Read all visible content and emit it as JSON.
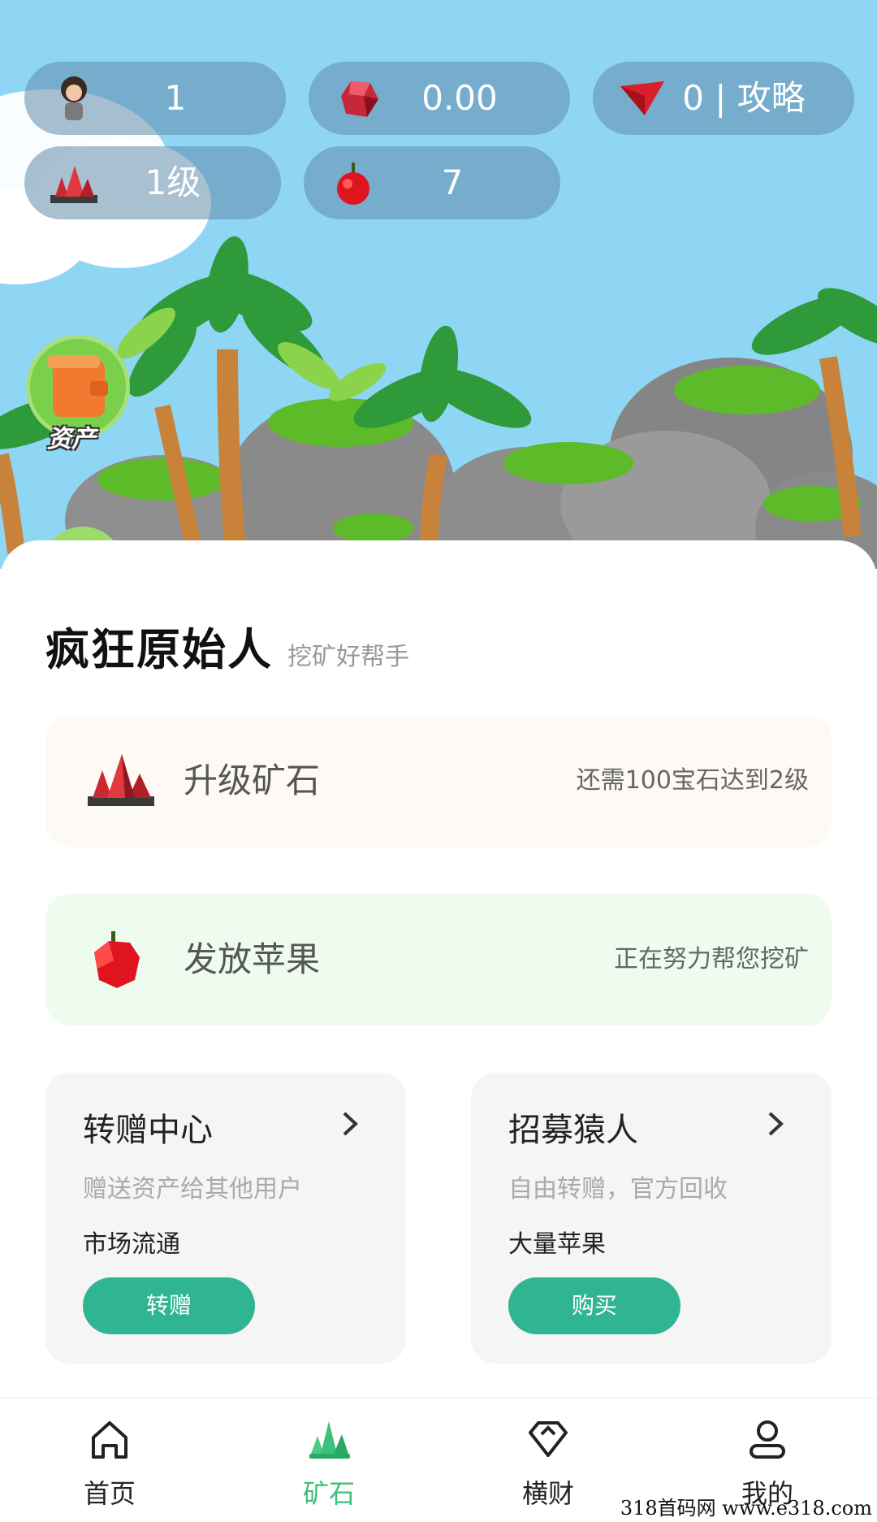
{
  "stats": {
    "avatar_count": "1",
    "gem_balance": "0.00",
    "guide": "0 | 攻略",
    "ore_level": "1级",
    "apple_count": "7"
  },
  "side": {
    "asset_label": "资产"
  },
  "header": {
    "title": "疯狂原始人",
    "subtitle": "挖矿好帮手"
  },
  "upgrade_card": {
    "label": "升级矿石",
    "note": "还需100宝石达到2级"
  },
  "apple_card": {
    "label": "发放苹果",
    "note": "正在努力帮您挖矿"
  },
  "transfer_card": {
    "title": "转赠中心",
    "desc": "赠送资产给其他用户",
    "sub": "市场流通",
    "button": "转赠"
  },
  "recruit_card": {
    "title": "招募猿人",
    "desc": "自由转赠，官方回收",
    "sub": "大量苹果",
    "button": "购买"
  },
  "nav": {
    "items": [
      {
        "label": "首页",
        "icon": "home-icon"
      },
      {
        "label": "矿石",
        "icon": "crystal-icon"
      },
      {
        "label": "横财",
        "icon": "diamond-icon"
      },
      {
        "label": "我的",
        "icon": "user-icon"
      }
    ],
    "active_index": 1
  },
  "watermark": "318首码网  www.e318.com",
  "colors": {
    "accent_green": "#2fb592",
    "nav_active": "#3cc07a",
    "sky": "#8fd6f5"
  }
}
